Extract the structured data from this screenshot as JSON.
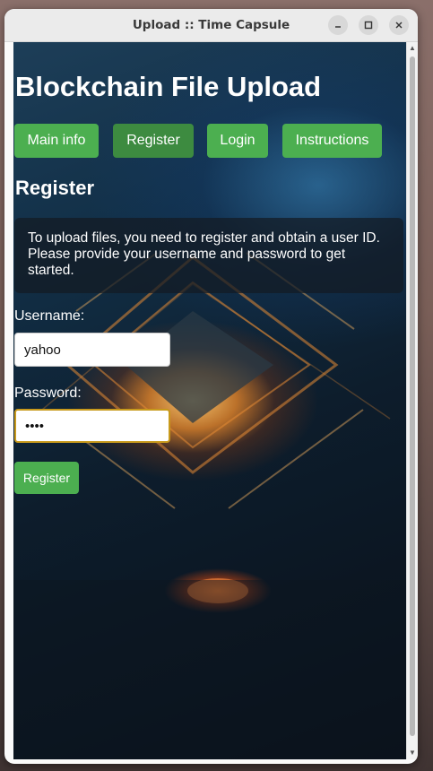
{
  "window": {
    "title": "Upload :: Time Capsule"
  },
  "page": {
    "heading": "Blockchain File Upload",
    "nav": [
      {
        "label": "Main info"
      },
      {
        "label": "Register",
        "active": true
      },
      {
        "label": "Login"
      },
      {
        "label": "Instructions"
      }
    ],
    "section_title": "Register",
    "info_text": "To upload files, you need to register and obtain a user ID. Please provide your username and password to get started."
  },
  "form": {
    "username_label": "Username:",
    "username_value": "yahoo",
    "password_label": "Password:",
    "password_masked": "••••",
    "submit_label": "Register"
  },
  "colors": {
    "accent": "#4caf50",
    "accent_active": "#3d8b40",
    "focus_border": "#c89a1c"
  },
  "icons": [
    "minimize-icon",
    "maximize-icon",
    "close-icon",
    "scroll-up-icon",
    "scroll-down-icon"
  ]
}
